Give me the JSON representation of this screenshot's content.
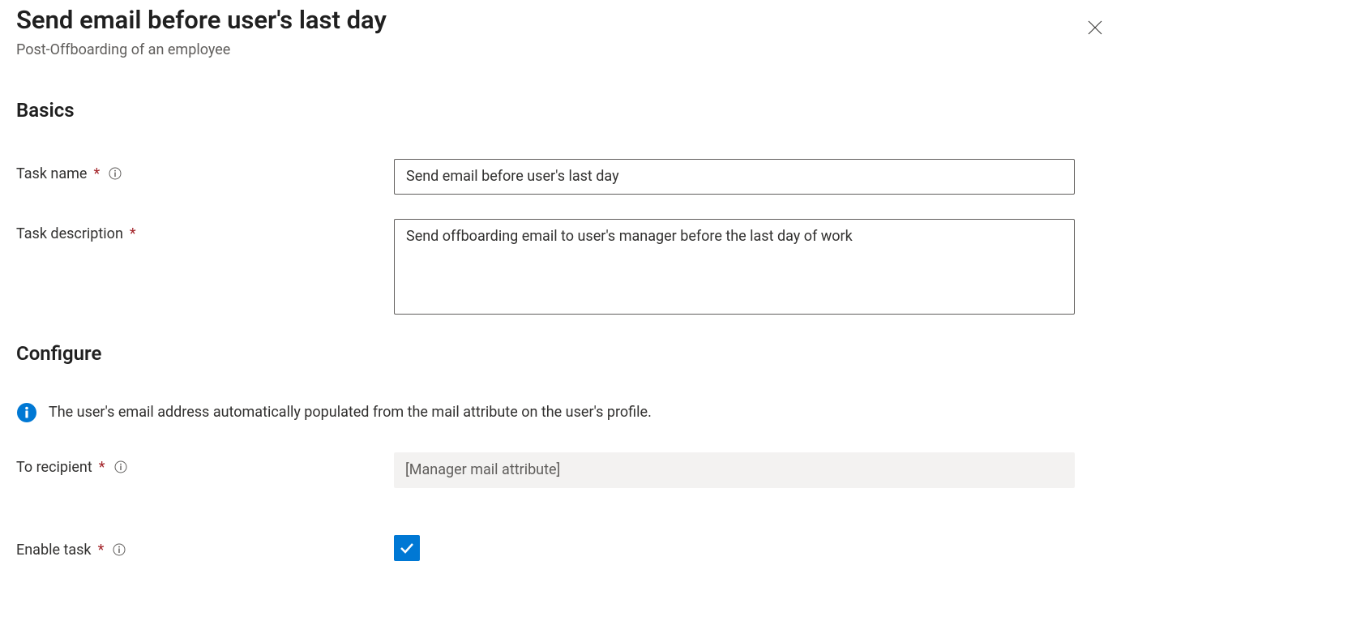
{
  "header": {
    "title": "Send email before user's last day",
    "subtitle": "Post-Offboarding of an employee"
  },
  "sections": {
    "basics": "Basics",
    "configure": "Configure"
  },
  "labels": {
    "task_name": "Task name",
    "task_description": "Task description",
    "to_recipient": "To recipient",
    "enable_task": "Enable task"
  },
  "fields": {
    "task_name_value": "Send email before user's last day",
    "task_description_value": "Send offboarding email to user's manager before the last day of work",
    "to_recipient_value": "[Manager mail attribute]",
    "enable_task_checked": true
  },
  "info_banner": "The user's email address automatically populated from the mail attribute on the user's profile.",
  "colors": {
    "required": "#a4262c",
    "primary": "#0078d4",
    "info_icon": "#0078d4"
  }
}
